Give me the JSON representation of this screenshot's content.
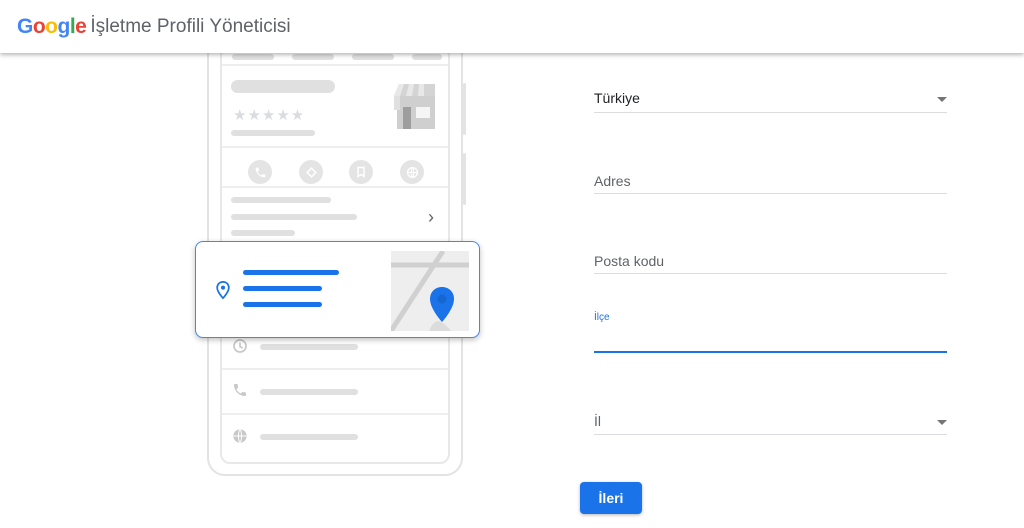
{
  "header": {
    "logo": {
      "text": "Google",
      "colors": [
        "#4285F4",
        "#EA4335",
        "#FBBC05",
        "#4285F4",
        "#34A853",
        "#EA4335"
      ]
    },
    "product_name": "İşletme Profili Yöneticisi"
  },
  "illustration": {
    "action_icons": [
      "phone-icon",
      "directions-icon",
      "bookmark-icon",
      "web-icon"
    ],
    "stars": "★★★★★",
    "chevron": "›"
  },
  "form": {
    "country": {
      "value": "Türkiye"
    },
    "address": {
      "placeholder": "Adres"
    },
    "postal_code": {
      "placeholder": "Posta kodu"
    },
    "district": {
      "label": "İlçe",
      "value": ""
    },
    "province": {
      "placeholder": "İl"
    },
    "next_button": "İleri"
  },
  "colors": {
    "accent": "#1a73e8"
  }
}
